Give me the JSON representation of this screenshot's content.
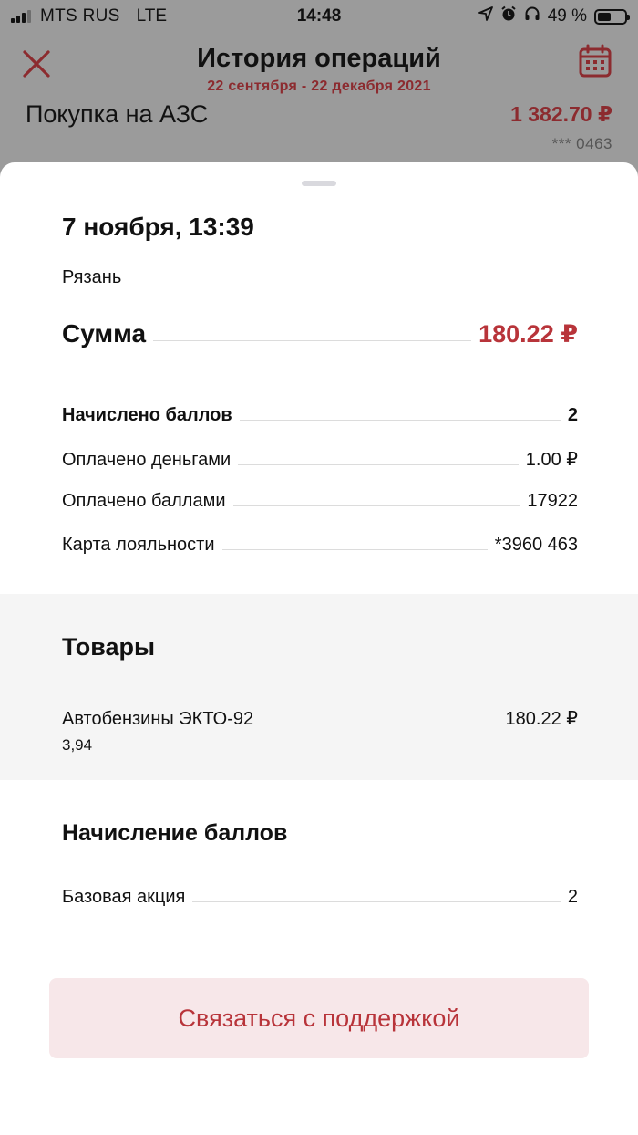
{
  "status_bar": {
    "carrier": "MTS RUS",
    "network": "LTE",
    "time": "14:48",
    "battery": "49 %"
  },
  "header": {
    "title": "История операций",
    "period": "22 сентября - 22 декабря 2021"
  },
  "background_operation": {
    "title": "Покупка на АЗС",
    "amount": "1 382.70 ₽",
    "card": "*** 0463"
  },
  "sheet": {
    "date": "7 ноября, 13:39",
    "city": "Рязань",
    "sum_label": "Сумма",
    "sum_value": "180.22 ₽",
    "details": [
      {
        "label": "Начислено баллов",
        "value": "2"
      },
      {
        "label": "Оплачено деньгами",
        "value": "1.00 ₽"
      },
      {
        "label": "Оплачено баллами",
        "value": "17922"
      },
      {
        "label": "Карта лояльности",
        "value": "*3960 463"
      }
    ],
    "goods_title": "Товары",
    "goods": [
      {
        "name": "Автобензины ЭКТО-92",
        "price": "180.22 ₽",
        "qty": "3,94"
      }
    ],
    "points_title": "Начисление баллов",
    "points": [
      {
        "label": "Базовая акция",
        "value": "2"
      }
    ],
    "support_button": "Связаться с поддержкой"
  },
  "colors": {
    "accent": "#b8343a",
    "accent_dim": "#8c2b2f",
    "button_bg": "#f7e7e9",
    "overlay": "#9b9b9b"
  },
  "icons": [
    "signal-icon",
    "location-arrow-icon",
    "alarm-icon",
    "headphones-icon",
    "battery-icon",
    "close-icon",
    "calendar-icon"
  ]
}
